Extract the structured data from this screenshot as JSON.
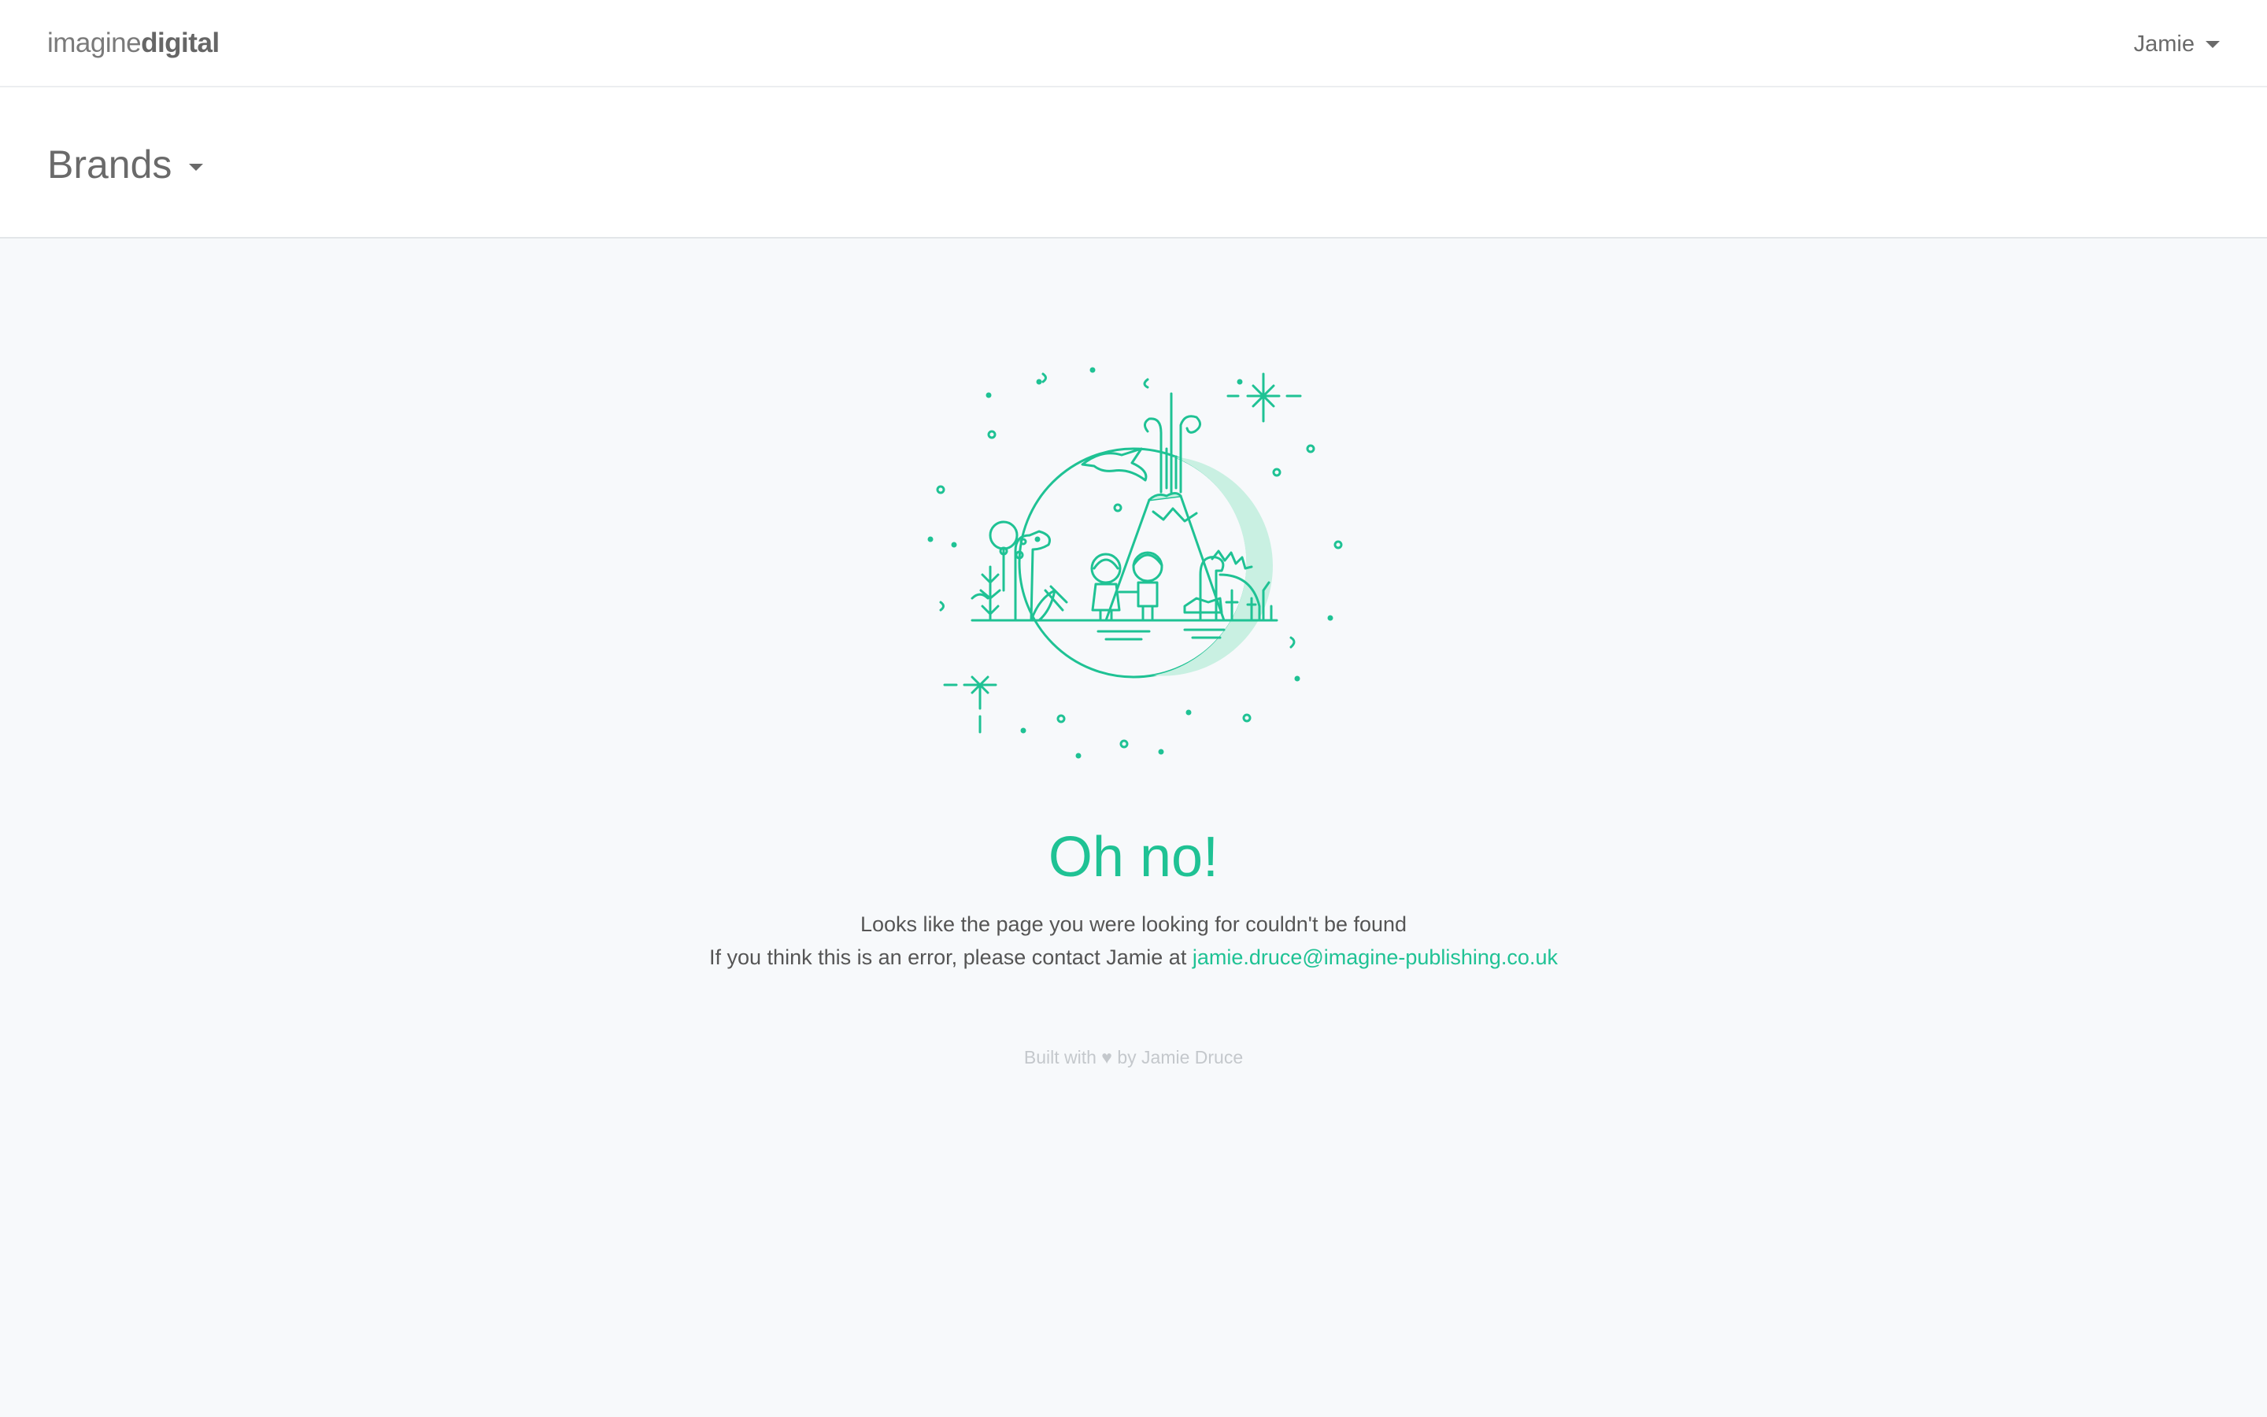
{
  "header": {
    "logo_light": "imagine",
    "logo_bold": "digital",
    "user_name": "Jamie"
  },
  "subheader": {
    "brands_label": "Brands"
  },
  "error": {
    "title": "Oh no!",
    "line1": "Looks like the page you were looking for couldn't be found",
    "line2_prefix": "If you think this is an error, please contact Jamie at ",
    "contact_email": "jamie.druce@imagine-publishing.co.uk"
  },
  "footer": {
    "built_with": "Built with",
    "heart": "♥",
    "by_text": "by Jamie Druce"
  },
  "colors": {
    "accent": "#1fc294",
    "background": "#f7f9fb",
    "text": "#555555",
    "muted": "#c4c8cc"
  },
  "icons": {
    "illustration": "dinosaur-volcano-illustration",
    "user_caret": "chevron-down-icon",
    "brands_caret": "chevron-down-icon"
  }
}
